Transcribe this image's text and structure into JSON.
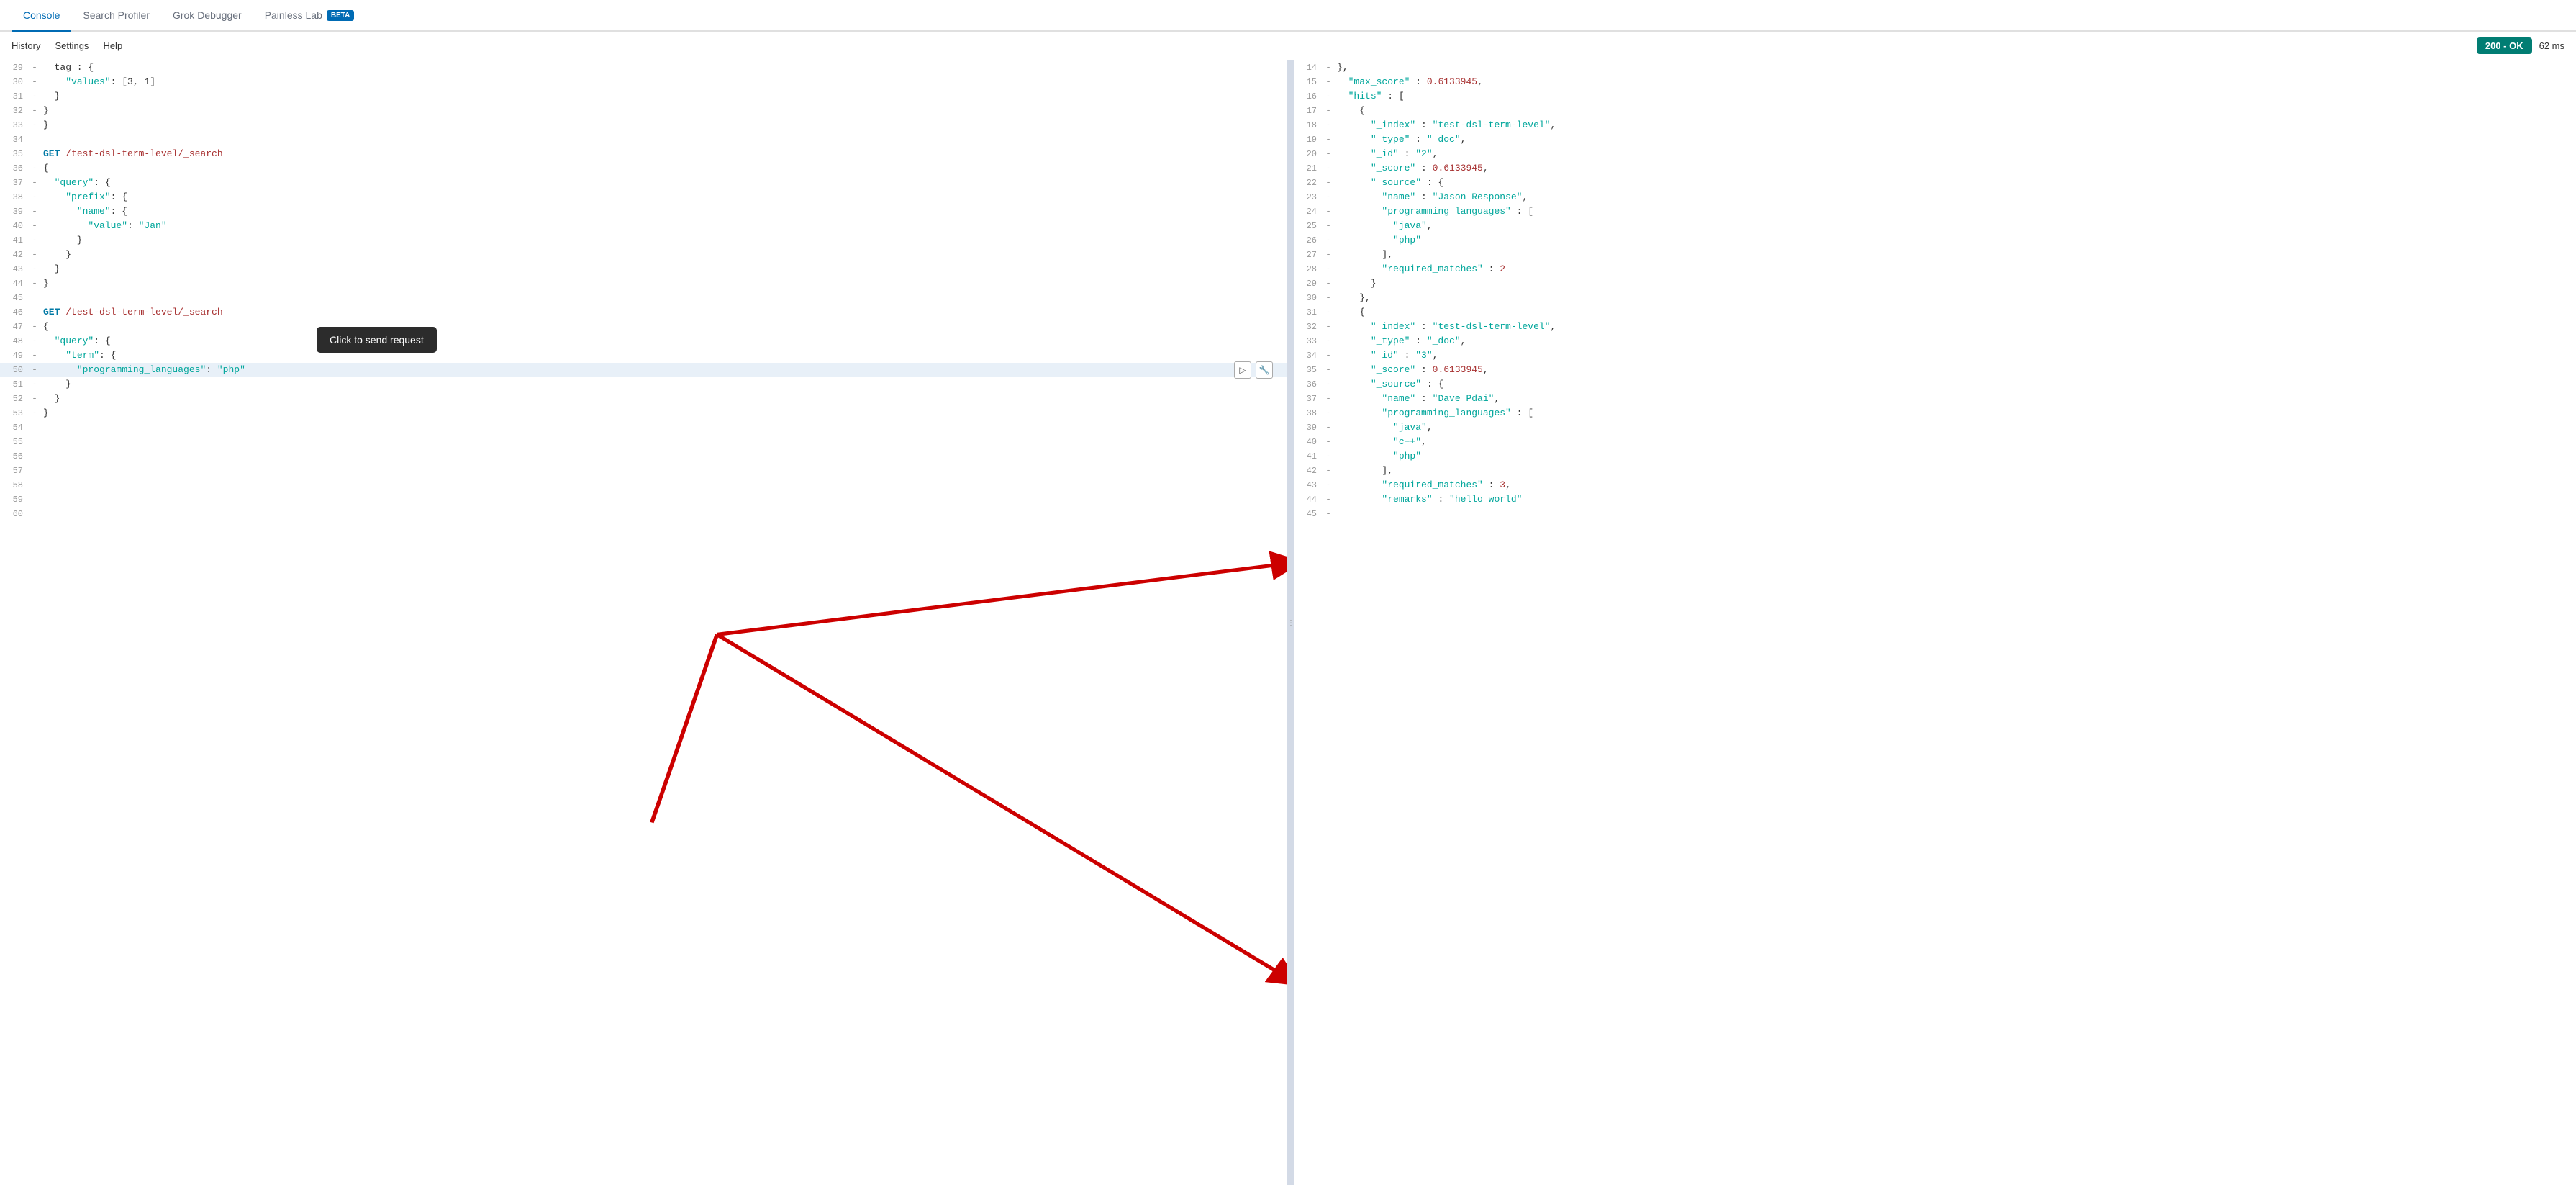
{
  "nav": {
    "items": [
      {
        "label": "Console",
        "active": true
      },
      {
        "label": "Search Profiler",
        "active": false
      },
      {
        "label": "Grok Debugger",
        "active": false
      },
      {
        "label": "Painless Lab",
        "active": false,
        "badge": "BETA"
      }
    ]
  },
  "subnav": {
    "items": [
      "History",
      "Settings",
      "Help"
    ],
    "status": "200 - OK",
    "time": "62 ms"
  },
  "tooltip": {
    "text": "Click to send request"
  },
  "editor": {
    "lines": [
      {
        "num": 29,
        "gutter": "-",
        "content": "  tag : {"
      },
      {
        "num": 30,
        "gutter": "-",
        "content": "    \"values\": [3, 1]"
      },
      {
        "num": 31,
        "gutter": "-",
        "content": "  }"
      },
      {
        "num": 32,
        "gutter": "-",
        "content": "}"
      },
      {
        "num": 33,
        "gutter": "-",
        "content": "}"
      },
      {
        "num": 34,
        "gutter": " ",
        "content": ""
      },
      {
        "num": 35,
        "gutter": " ",
        "content": "GET /test-dsl-term-level/_search",
        "type": "method"
      },
      {
        "num": 36,
        "gutter": "-",
        "content": "{"
      },
      {
        "num": 37,
        "gutter": "-",
        "content": "  \"query\": {"
      },
      {
        "num": 38,
        "gutter": "-",
        "content": "    \"prefix\": {"
      },
      {
        "num": 39,
        "gutter": "-",
        "content": "      \"name\": {"
      },
      {
        "num": 40,
        "gutter": "-",
        "content": "        \"value\": \"Jan\""
      },
      {
        "num": 41,
        "gutter": "-",
        "content": "      }"
      },
      {
        "num": 42,
        "gutter": "-",
        "content": "    }"
      },
      {
        "num": 43,
        "gutter": "-",
        "content": "  }"
      },
      {
        "num": 44,
        "gutter": "-",
        "content": "}"
      },
      {
        "num": 45,
        "gutter": " ",
        "content": ""
      },
      {
        "num": 46,
        "gutter": " ",
        "content": "GET /test-dsl-term-level/_search",
        "type": "method"
      },
      {
        "num": 47,
        "gutter": "-",
        "content": "{"
      },
      {
        "num": 48,
        "gutter": "-",
        "content": "  \"query\": {"
      },
      {
        "num": 49,
        "gutter": "-",
        "content": "    \"term\": {"
      },
      {
        "num": 50,
        "gutter": "-",
        "content": "      \"programming_languages\": \"php\"",
        "highlight": true
      },
      {
        "num": 51,
        "gutter": "-",
        "content": "    }"
      },
      {
        "num": 52,
        "gutter": "-",
        "content": "  }"
      },
      {
        "num": 53,
        "gutter": "-",
        "content": "}"
      },
      {
        "num": 54,
        "gutter": " ",
        "content": ""
      },
      {
        "num": 55,
        "gutter": " ",
        "content": ""
      },
      {
        "num": 56,
        "gutter": " ",
        "content": ""
      },
      {
        "num": 57,
        "gutter": " ",
        "content": ""
      },
      {
        "num": 58,
        "gutter": " ",
        "content": ""
      },
      {
        "num": 59,
        "gutter": " ",
        "content": ""
      },
      {
        "num": 60,
        "gutter": " ",
        "content": ""
      }
    ]
  },
  "response": {
    "lines": [
      {
        "num": 14,
        "gutter": "-",
        "content": "},"
      },
      {
        "num": 15,
        "gutter": "-",
        "content": "  \"max_score\" : 0.6133945,"
      },
      {
        "num": 16,
        "gutter": "-",
        "content": "  \"hits\" : ["
      },
      {
        "num": 17,
        "gutter": "-",
        "content": "    {"
      },
      {
        "num": 18,
        "gutter": "-",
        "content": "      \"_index\" : \"test-dsl-term-level\","
      },
      {
        "num": 19,
        "gutter": "-",
        "content": "      \"_type\" : \"_doc\","
      },
      {
        "num": 20,
        "gutter": "-",
        "content": "      \"_id\" : \"2\","
      },
      {
        "num": 21,
        "gutter": "-",
        "content": "      \"_score\" : 0.6133945,"
      },
      {
        "num": 22,
        "gutter": "-",
        "content": "      \"_source\" : {"
      },
      {
        "num": 23,
        "gutter": "-",
        "content": "        \"name\" : \"Jason Response\","
      },
      {
        "num": 24,
        "gutter": "-",
        "content": "        \"programming_languages\" : ["
      },
      {
        "num": 25,
        "gutter": "-",
        "content": "          \"java\","
      },
      {
        "num": 26,
        "gutter": "-",
        "content": "          \"php\""
      },
      {
        "num": 27,
        "gutter": "-",
        "content": "        ],"
      },
      {
        "num": 28,
        "gutter": "-",
        "content": "        \"required_matches\" : 2"
      },
      {
        "num": 29,
        "gutter": "-",
        "content": "      }"
      },
      {
        "num": 30,
        "gutter": "-",
        "content": "    },"
      },
      {
        "num": 31,
        "gutter": "-",
        "content": "    {"
      },
      {
        "num": 32,
        "gutter": "-",
        "content": "      \"_index\" : \"test-dsl-term-level\","
      },
      {
        "num": 33,
        "gutter": "-",
        "content": "      \"_type\" : \"_doc\","
      },
      {
        "num": 34,
        "gutter": "-",
        "content": "      \"_id\" : \"3\","
      },
      {
        "num": 35,
        "gutter": "-",
        "content": "      \"_score\" : 0.6133945,"
      },
      {
        "num": 36,
        "gutter": "-",
        "content": "      \"_source\" : {"
      },
      {
        "num": 37,
        "gutter": "-",
        "content": "        \"name\" : \"Dave Pdai\","
      },
      {
        "num": 38,
        "gutter": "-",
        "content": "        \"programming_languages\" : ["
      },
      {
        "num": 39,
        "gutter": "-",
        "content": "          \"java\","
      },
      {
        "num": 40,
        "gutter": "-",
        "content": "          \"c++\","
      },
      {
        "num": 41,
        "gutter": "-",
        "content": "          \"php\""
      },
      {
        "num": 42,
        "gutter": "-",
        "content": "        ],"
      },
      {
        "num": 43,
        "gutter": "-",
        "content": "        \"required_matches\" : 3,"
      },
      {
        "num": 44,
        "gutter": "-",
        "content": "        \"remarks\" : \"hello world\""
      },
      {
        "num": 45,
        "gutter": "-",
        "content": ""
      }
    ]
  }
}
